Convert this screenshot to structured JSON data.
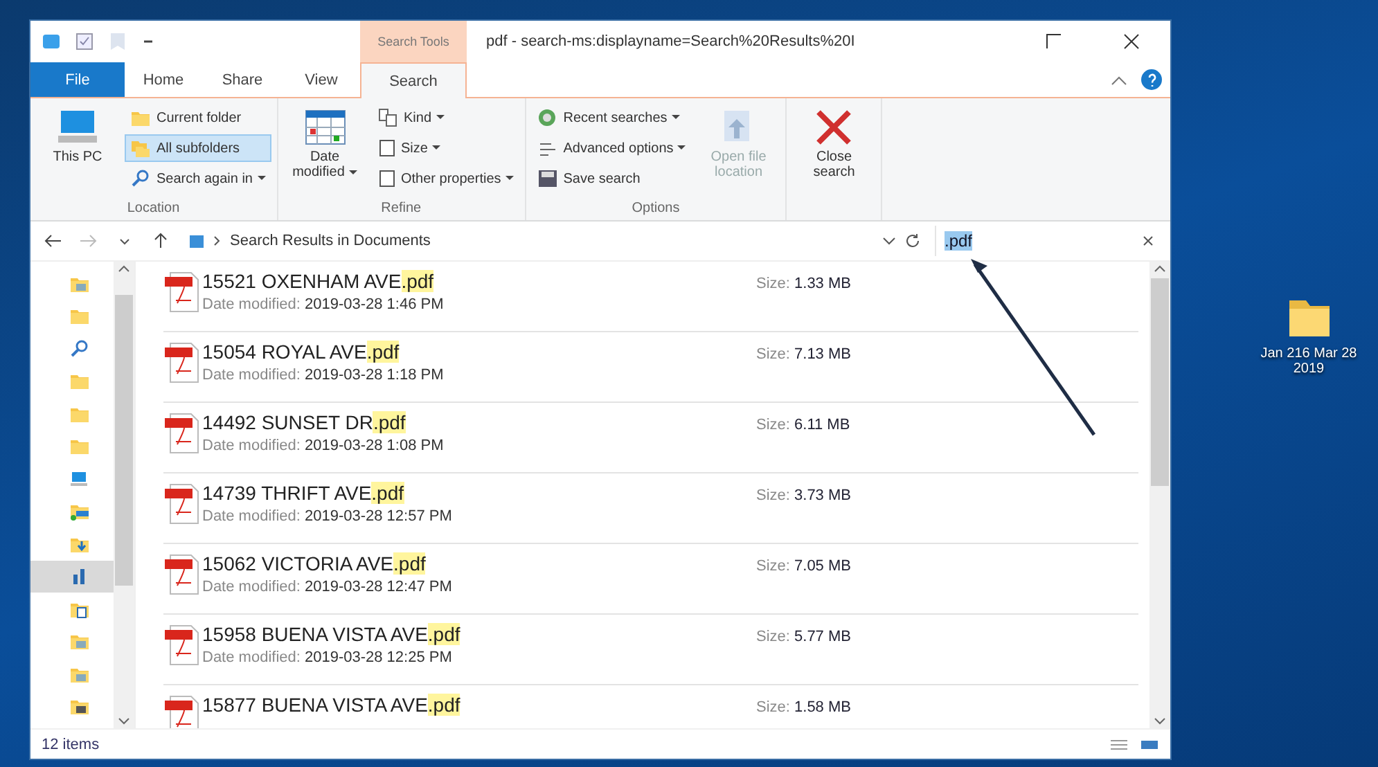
{
  "window": {
    "title": "pdf - search-ms:displayname=Search%20Results%20I",
    "context_tab": "Search Tools"
  },
  "tabs": [
    {
      "label": "File",
      "kind": "file",
      "selected": false
    },
    {
      "label": "Home",
      "kind": "tab",
      "selected": false
    },
    {
      "label": "Share",
      "kind": "tab",
      "selected": false
    },
    {
      "label": "View",
      "kind": "tab",
      "selected": false
    },
    {
      "label": "Search",
      "kind": "tab",
      "selected": true
    }
  ],
  "ribbon": [
    {
      "label": "Location",
      "items": [
        {
          "kind": "large",
          "label": "This PC",
          "dropdown": false,
          "selected": false,
          "disabled": false
        },
        {
          "kind": "small",
          "label": "Current folder",
          "dropdown": false,
          "selected": false,
          "disabled": false
        },
        {
          "kind": "small",
          "label": "All subfolders",
          "dropdown": false,
          "selected": true,
          "disabled": false
        },
        {
          "kind": "small",
          "label": "Search again in",
          "dropdown": true,
          "selected": false,
          "disabled": false
        }
      ]
    },
    {
      "label": "Refine",
      "items": [
        {
          "kind": "large",
          "label": "Date modified",
          "dropdown": true,
          "selected": false,
          "disabled": false
        },
        {
          "kind": "small",
          "label": "Kind",
          "dropdown": true,
          "selected": false,
          "disabled": false
        },
        {
          "kind": "small",
          "label": "Size",
          "dropdown": true,
          "selected": false,
          "disabled": false
        },
        {
          "kind": "small",
          "label": "Other properties",
          "dropdown": true,
          "selected": false,
          "disabled": false
        }
      ]
    },
    {
      "label": "Options",
      "items": [
        {
          "kind": "small",
          "label": "Recent searches",
          "dropdown": true,
          "selected": false,
          "disabled": false
        },
        {
          "kind": "small",
          "label": "Advanced options",
          "dropdown": true,
          "selected": false,
          "disabled": false
        },
        {
          "kind": "small",
          "label": "Save search",
          "dropdown": false,
          "selected": false,
          "disabled": false
        },
        {
          "kind": "large",
          "label": "Open file location",
          "dropdown": false,
          "selected": false,
          "disabled": true
        }
      ]
    },
    {
      "items": [
        {
          "kind": "large",
          "label": "Close search",
          "dropdown": false,
          "selected": false,
          "disabled": false
        }
      ]
    }
  ],
  "address": {
    "path": "Search Results in Documents",
    "search": ".pdf"
  },
  "nav_items": [
    {
      "selected": false
    },
    {
      "selected": false
    },
    {
      "selected": false
    },
    {
      "selected": false
    },
    {
      "selected": false
    },
    {
      "selected": false
    },
    {
      "selected": false
    },
    {
      "selected": false
    },
    {
      "selected": false
    },
    {
      "selected": true
    },
    {
      "selected": false
    },
    {
      "selected": false
    },
    {
      "selected": false
    },
    {
      "selected": false
    }
  ],
  "files": [
    {
      "name": "15521 OXENHAM AVE",
      "ext": ".pdf",
      "date_label": "Date modified:",
      "date": "2019-03-28 1:46 PM",
      "size_label": "Size:",
      "size": "1.33 MB"
    },
    {
      "name": "15054 ROYAL AVE",
      "ext": ".pdf",
      "date_label": "Date modified:",
      "date": "2019-03-28 1:18 PM",
      "size_label": "Size:",
      "size": "7.13 MB"
    },
    {
      "name": "14492 SUNSET DR",
      "ext": ".pdf",
      "date_label": "Date modified:",
      "date": "2019-03-28 1:08 PM",
      "size_label": "Size:",
      "size": "6.11 MB"
    },
    {
      "name": "14739 THRIFT AVE",
      "ext": ".pdf",
      "date_label": "Date modified:",
      "date": "2019-03-28 12:57 PM",
      "size_label": "Size:",
      "size": "3.73 MB"
    },
    {
      "name": "15062 VICTORIA AVE",
      "ext": ".pdf",
      "date_label": "Date modified:",
      "date": "2019-03-28 12:47 PM",
      "size_label": "Size:",
      "size": "7.05 MB"
    },
    {
      "name": "15958 BUENA VISTA AVE",
      "ext": ".pdf",
      "date_label": "Date modified:",
      "date": "2019-03-28 12:25 PM",
      "size_label": "Size:",
      "size": "5.77 MB"
    },
    {
      "name": "15877 BUENA VISTA AVE",
      "ext": ".pdf",
      "size_label": "Size:",
      "size": "1.58 MB"
    }
  ],
  "status_bar": {
    "items": "12 items"
  },
  "desktop": {
    "folder_label": "Jan 216 Mar 28 2019"
  }
}
